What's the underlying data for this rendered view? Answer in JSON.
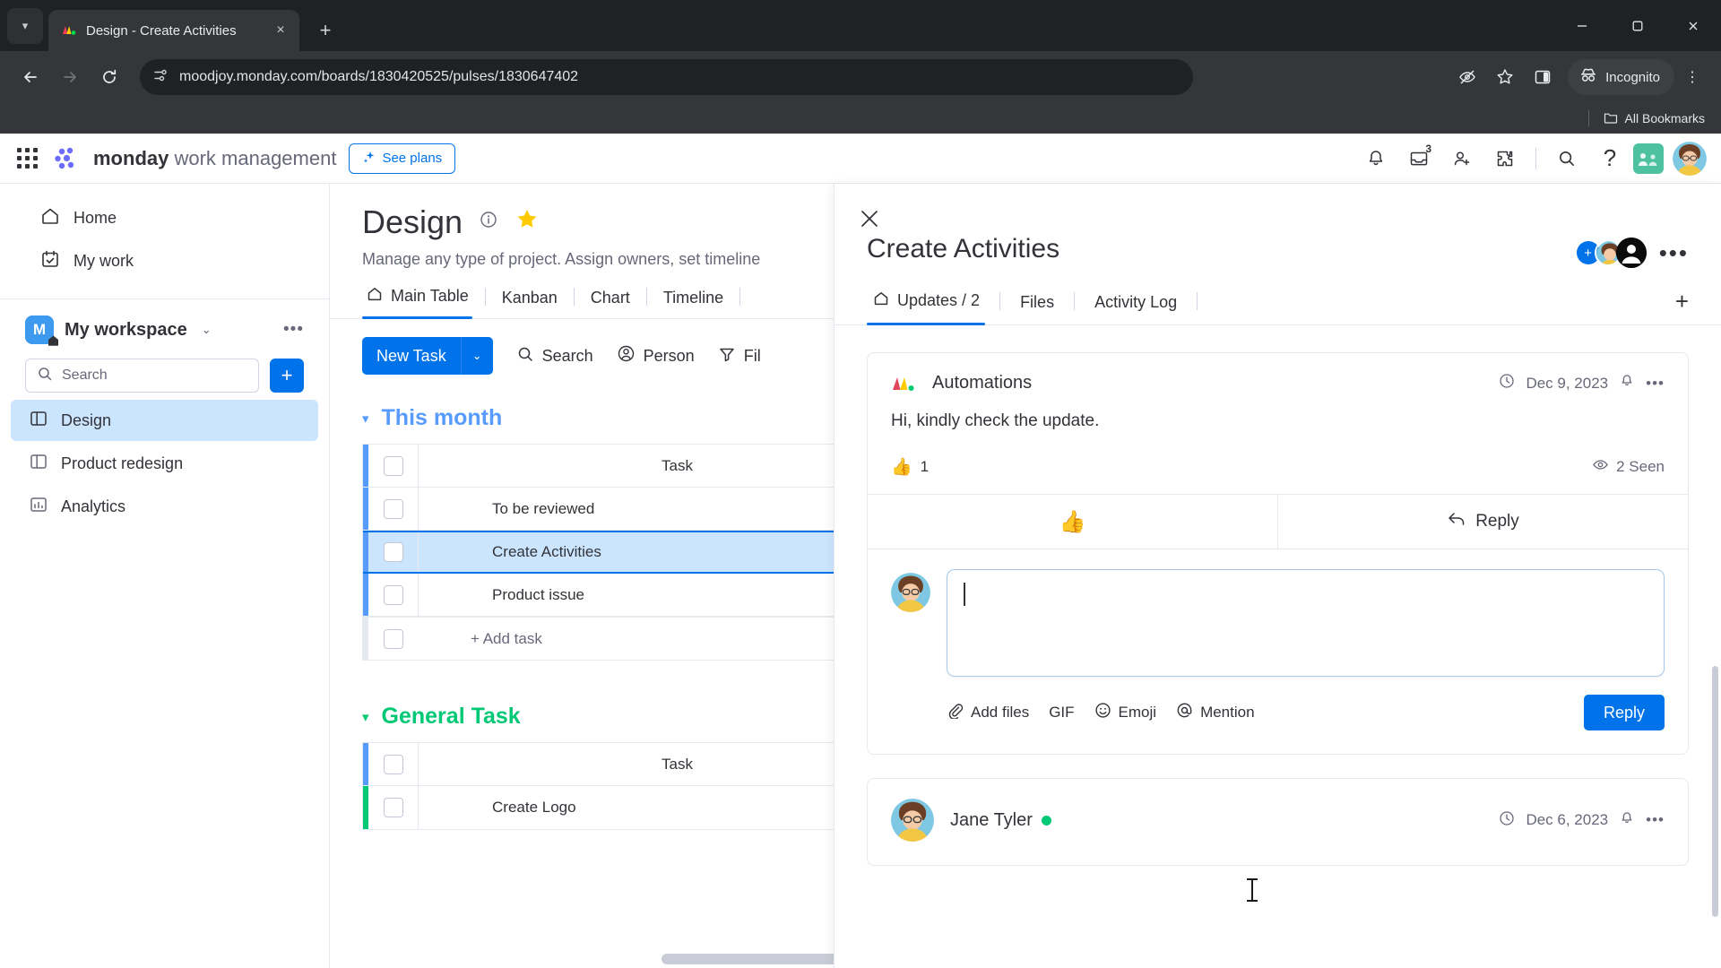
{
  "browser": {
    "tab": {
      "title": "Design - Create Activities",
      "favicon": "monday-logo-icon",
      "close": "×"
    },
    "new_tab_label": "+",
    "window": {
      "minimize": "—",
      "maximize": "▢",
      "close": "✕"
    },
    "nav": {
      "back": "←",
      "forward": "→",
      "reload": "⟳"
    },
    "omnibox": {
      "url": "moodjoy.monday.com/boards/1830420525/pulses/1830647402",
      "site_icon": "site-settings-icon"
    },
    "toolbar_right": {
      "tracking_protection": "eye-off-icon",
      "bookmark": "star-icon",
      "side_panel": "side-panel-icon",
      "incognito_label": "Incognito",
      "menu": "⋮"
    },
    "bookmarks": {
      "all_bookmarks": "All Bookmarks",
      "folder_icon": "folder-icon"
    }
  },
  "app_header": {
    "brand_bold": "monday",
    "brand_rest": " work management",
    "see_plans": "See plans",
    "icons": {
      "notifications": "bell-icon",
      "inbox": "inbox-icon",
      "inbox_badge": "3",
      "invite": "add-person-icon",
      "apps": "puzzle-icon",
      "search": "search-icon",
      "help": "?"
    }
  },
  "sidebar": {
    "items": [
      {
        "label": "Home",
        "icon": "home-icon"
      },
      {
        "label": "My work",
        "icon": "calendar-check-icon"
      }
    ],
    "workspace": {
      "initial": "M",
      "name": "My workspace",
      "chevron": "⌄",
      "more": "•••"
    },
    "search": {
      "placeholder": "Search",
      "icon": "search-icon"
    },
    "add_button": "+",
    "boards": [
      {
        "label": "Design",
        "icon": "board-icon",
        "active": true
      },
      {
        "label": "Product redesign",
        "icon": "board-icon",
        "active": false
      },
      {
        "label": "Analytics",
        "icon": "dashboard-icon",
        "active": false
      }
    ]
  },
  "board": {
    "title": "Design",
    "subtitle": "Manage any type of project. Assign owners, set timeline",
    "tabs": [
      {
        "label": "Main Table",
        "icon": "home-icon",
        "active": true
      },
      {
        "label": "Kanban",
        "active": false
      },
      {
        "label": "Chart",
        "active": false
      },
      {
        "label": "Timeline",
        "active": false
      }
    ],
    "toolbar": {
      "new_task": "New Task",
      "new_task_caret": "⌄",
      "search": "Search",
      "person": "Person",
      "filter": "Fil"
    },
    "groups": [
      {
        "name": "This month",
        "color": "blue",
        "column_header": "Task",
        "rows": [
          {
            "task": "To be reviewed",
            "selected": false,
            "has_check": false
          },
          {
            "task": "Create Activities",
            "selected": true,
            "has_check": true
          },
          {
            "task": "Product issue",
            "selected": false,
            "has_check": false
          }
        ],
        "add_row": "+ Add task"
      },
      {
        "name": "General Task",
        "color": "green",
        "column_header": "Task",
        "rows": [
          {
            "task": "Create Logo",
            "selected": false,
            "has_check": false
          }
        ]
      }
    ]
  },
  "panel": {
    "close": "✕",
    "title": "Create Activities",
    "header_more": "•••",
    "avatar_add": "+",
    "tabs": [
      {
        "label": "Updates / 2",
        "icon": "home-icon",
        "active": true
      },
      {
        "label": "Files",
        "active": false
      },
      {
        "label": "Activity Log",
        "active": false
      }
    ],
    "add_tab": "+",
    "updates": [
      {
        "author": "Automations",
        "author_icon": "monday-automations-icon",
        "date": "Dec 9, 2023",
        "bell": "bell-icon",
        "more": "•••",
        "body": "Hi, kindly check the update.",
        "like_emoji": "👍",
        "like_count": "1",
        "seen_icon": "eye-icon",
        "seen_text": "2 Seen",
        "actions": [
          {
            "label": "",
            "emoji": "👍",
            "name": "like"
          },
          {
            "label": "Reply",
            "icon": "reply-icon",
            "name": "reply"
          }
        ]
      },
      {
        "author": "Jane Tyler",
        "online": true,
        "date": "Dec 6, 2023",
        "bell": "bell-icon",
        "more": "•••"
      }
    ],
    "composer": {
      "value": "",
      "tools": [
        {
          "label": "Add files",
          "icon": "paperclip-icon"
        },
        {
          "label": "GIF",
          "icon": "gif-icon"
        },
        {
          "label": "Emoji",
          "icon": "smiley-icon"
        },
        {
          "label": "Mention",
          "icon": "at-icon"
        }
      ],
      "reply_button": "Reply"
    }
  },
  "colors": {
    "accent_blue": "#0073ea",
    "selected_row": "#cce5ff",
    "green": "#00c875",
    "group_blue": "#579bfc"
  }
}
